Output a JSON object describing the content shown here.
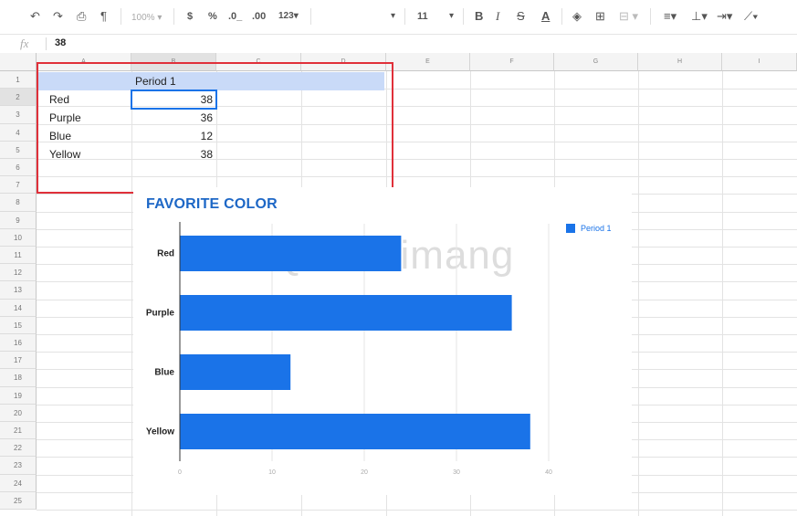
{
  "toolbar": {
    "zoom": "100%",
    "currency": "$",
    "percent": "%",
    "dec_decrease": ".0_",
    "dec_increase": ".00",
    "more_formats": "123",
    "font_size": "11",
    "bold": "B",
    "italic": "I",
    "strike": "S",
    "text_color": "A"
  },
  "formula_bar": {
    "fx": "fx",
    "value": "38"
  },
  "columns": [
    "A",
    "B",
    "C",
    "D",
    "E",
    "F",
    "G",
    "H",
    "I"
  ],
  "rows": [
    "1",
    "2",
    "3",
    "4",
    "5",
    "6",
    "7",
    "8",
    "9",
    "10",
    "11",
    "12",
    "13",
    "14",
    "15",
    "16",
    "17",
    "18",
    "19",
    "20",
    "21",
    "22",
    "23",
    "24",
    "25"
  ],
  "sheet": {
    "header": "Period 1",
    "labels": [
      "Red",
      "Purple",
      "Blue",
      "Yellow"
    ],
    "values": [
      "38",
      "36",
      "12",
      "38"
    ]
  },
  "watermark": "Quantrimang",
  "chart_data": {
    "type": "bar",
    "orientation": "horizontal",
    "title": "FAVORITE COLOR",
    "categories": [
      "Red",
      "Purple",
      "Blue",
      "Yellow"
    ],
    "series": [
      {
        "name": "Period 1",
        "values": [
          24,
          36,
          12,
          38
        ]
      }
    ],
    "xlim": [
      0,
      40
    ],
    "xticks": [
      "0",
      "10",
      "20",
      "30",
      "40"
    ],
    "grid": true,
    "legend": "top-right",
    "color": "#1a73e8"
  }
}
